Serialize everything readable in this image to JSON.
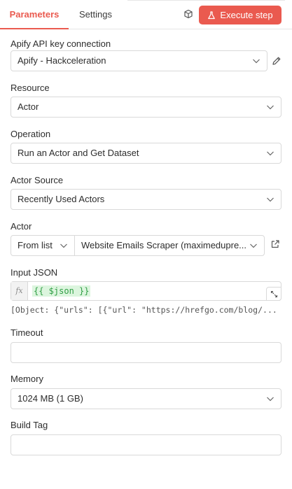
{
  "tabs": {
    "parameters": "Parameters",
    "settings": "Settings"
  },
  "execute_button": "Execute step",
  "credential": {
    "label": "Apify API key connection",
    "value": "Apify - Hackceleration"
  },
  "resource": {
    "label": "Resource",
    "value": "Actor"
  },
  "operation": {
    "label": "Operation",
    "value": "Run an Actor and Get Dataset"
  },
  "actor_source": {
    "label": "Actor Source",
    "value": "Recently Used Actors"
  },
  "actor": {
    "label": "Actor",
    "mode": "From list",
    "value": "Website Emails Scraper (maximedupre..."
  },
  "input_json": {
    "label": "Input JSON",
    "fx": "fx",
    "expression": "{{ $json }}",
    "preview": "[Object: {\"urls\": [{\"url\": \"https://hrefgo.com/blog/..."
  },
  "timeout": {
    "label": "Timeout",
    "value": ""
  },
  "memory": {
    "label": "Memory",
    "value": "1024 MB (1 GB)"
  },
  "build_tag": {
    "label": "Build Tag",
    "value": ""
  },
  "colors": {
    "accent": "#ea5a4f",
    "expression_bg": "#dcf5de",
    "expression_text": "#2f9e44"
  },
  "icons": [
    "cube-icon",
    "flask-icon",
    "chevron-down-icon",
    "pencil-icon",
    "external-link-icon",
    "expand-icon"
  ]
}
